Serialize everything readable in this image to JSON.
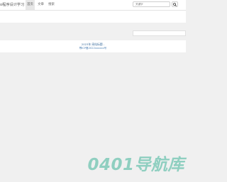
{
  "navbar": {
    "brand": "o程序设计学习",
    "items": [
      {
        "label": "首页",
        "active": true
      },
      {
        "label": "文章",
        "active": false
      },
      {
        "label": "搜索",
        "active": false
      }
    ],
    "search_placeholder": "关键字",
    "search_icon": "search-icon"
  },
  "footer": {
    "copyright": "2023年 网站标题 -",
    "icp": "鄂ICP备2022xxxxxx号"
  },
  "watermark": "0401导航库",
  "colors": {
    "background": "#f0f0f0",
    "link": "#3c6e9e",
    "watermark": "#8fcfc0"
  }
}
